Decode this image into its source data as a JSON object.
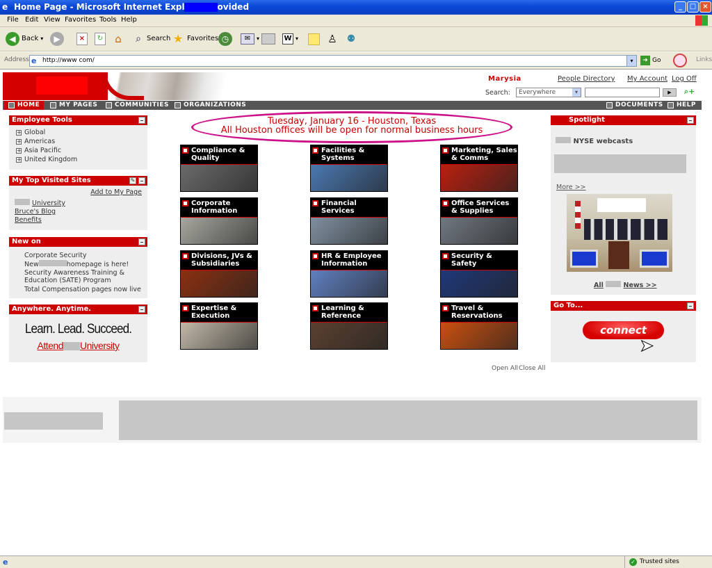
{
  "window": {
    "title": "Home Page - Microsoft Internet Explorer provided",
    "min": "_",
    "max": "□",
    "close": "×"
  },
  "menu": [
    "File",
    "Edit",
    "View",
    "Favorites",
    "Tools",
    "Help"
  ],
  "toolbar": {
    "back": "Back",
    "search": "Search",
    "favorites": "Favorites"
  },
  "address": {
    "label": "Address",
    "url": "http://www           com/",
    "go": "Go",
    "links": "Links"
  },
  "header": {
    "user": "Marysia",
    "people_directory": "People Directory",
    "my_account": "My Account",
    "log_off": "Log Off",
    "search_label": "Search:",
    "search_scope": "Everywhere"
  },
  "nav": {
    "home": "HOME",
    "my_pages": "MY PAGES",
    "communities": "COMMUNITIES",
    "organizations": "ORGANIZATIONS",
    "documents": "DOCUMENTS",
    "help": "HELP"
  },
  "announcement": {
    "line1": "Tuesday, January 16 - Houston, Texas",
    "line2": "All Houston offices will be open for normal business hours"
  },
  "employee_tools": {
    "title": "Employee Tools",
    "items": [
      "Global",
      "Americas",
      "Asia Pacific",
      "United Kingdom"
    ]
  },
  "top_sites": {
    "title": "My Top Visited Sites",
    "add": "Add to My Page",
    "items": [
      "University",
      "Bruce's Blog",
      "Benefits"
    ]
  },
  "new_on": {
    "title": "New on",
    "items": [
      "Corporate Security",
      "New",
      "homepage is here!",
      "Security Awareness Training &",
      "Education (SATE) Program",
      "Total Compensation pages now live"
    ]
  },
  "anywhere": {
    "title": "Anywhere. Anytime.",
    "slogan": "Learn. Lead. Succeed.",
    "attend": "Attend",
    "university": "University"
  },
  "tiles": [
    {
      "label": "Compliance & Quality",
      "color": "#6a6a6a"
    },
    {
      "label": "Facilities & Systems",
      "color": "#4a78b0"
    },
    {
      "label": "Marketing, Sales & Comms",
      "color": "#b82010"
    },
    {
      "label": "Corporate Information",
      "color": "#a8a8a0"
    },
    {
      "label": "Financial Services",
      "color": "#8090a0"
    },
    {
      "label": "Office Services & Supplies",
      "color": "#707880"
    },
    {
      "label": "Divisions, JVs & Subsidiaries",
      "color": "#8a3010"
    },
    {
      "label": "HR & Employee Information",
      "color": "#6080c0"
    },
    {
      "label": "Security & Safety",
      "color": "#203878"
    },
    {
      "label": "Expertise & Execution",
      "color": "#c0b8a8"
    },
    {
      "label": "Learning & Reference",
      "color": "#5a4030"
    },
    {
      "label": "Travel & Reservations",
      "color": "#c85010"
    }
  ],
  "open_all": "Open All",
  "close_all": "Close All",
  "spotlight": {
    "title": "Spotlight",
    "nyse": "NYSE webcasts",
    "more": "More >>",
    "all": "All",
    "news": "News >>"
  },
  "goto": {
    "title": "Go To...",
    "connect": "connect"
  },
  "status": {
    "zone": "Trusted sites"
  }
}
